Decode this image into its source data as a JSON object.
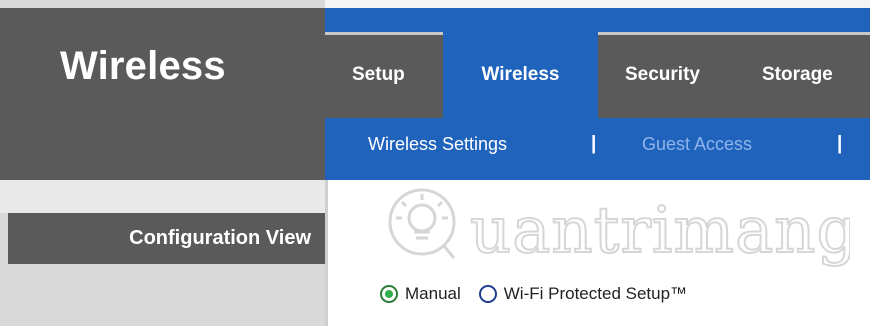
{
  "page": {
    "title": "Wireless",
    "config_view_label": "Configuration View"
  },
  "colors": {
    "header_gray": "#5a5a5a",
    "accent_blue": "#1f63bd",
    "sub_link_inactive": "#8fb4ea",
    "radio_selected": "#2fb04a"
  },
  "tabs": [
    {
      "label": "Setup",
      "active": false
    },
    {
      "label": "Wireless",
      "active": true
    },
    {
      "label": "Security",
      "active": false
    },
    {
      "label": "Storage",
      "active": false
    }
  ],
  "subnav": [
    {
      "label": "Wireless Settings",
      "active": true
    },
    {
      "label": "Guest Access",
      "active": false
    }
  ],
  "subnav_separator": "|",
  "config_mode": {
    "options": [
      {
        "label": "Manual",
        "selected": true
      },
      {
        "label": "Wi-Fi Protected Setup™",
        "selected": false
      }
    ]
  },
  "watermark": {
    "icon": "lightbulb-icon",
    "text": "uantrimang"
  }
}
